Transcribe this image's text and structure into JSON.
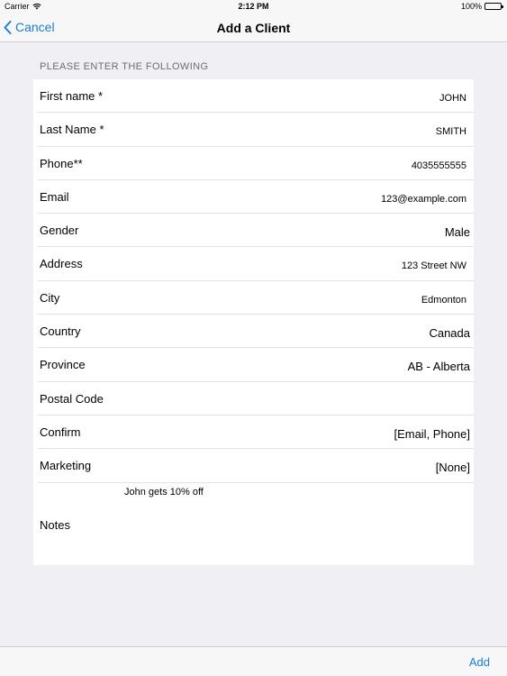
{
  "status": {
    "carrier": "Carrier",
    "time": "2:12 PM",
    "battery": "100%"
  },
  "nav": {
    "back_label": "Cancel",
    "title": "Add a Client"
  },
  "section_header": "PLEASE ENTER THE FOLLOWING",
  "fields": [
    {
      "label": "First name *",
      "value": "JOHN"
    },
    {
      "label": "Last Name *",
      "value": "SMITH"
    },
    {
      "label": "Phone**",
      "value": "4035555555"
    },
    {
      "label": "Email",
      "value": "123@example.com"
    },
    {
      "label": "Gender",
      "value": "Male"
    },
    {
      "label": "Address",
      "value": "123 Street NW"
    },
    {
      "label": "City",
      "value": "Edmonton"
    },
    {
      "label": "Country",
      "value": "Canada"
    },
    {
      "label": "Province",
      "value": "AB - Alberta"
    },
    {
      "label": "Postal Code",
      "value": ""
    },
    {
      "label": "Confirm",
      "value": "[Email, Phone]"
    },
    {
      "label": "Marketing",
      "value": "[None]"
    }
  ],
  "notes": {
    "label": "Notes",
    "text": "John gets 10% off"
  },
  "toolbar": {
    "add_label": "Add"
  },
  "colors": {
    "accent": "#1a7fe0",
    "background": "#efeff4"
  },
  "icons": {
    "wifi": "wifi-icon",
    "battery": "battery-icon",
    "back": "chevron-left-icon"
  }
}
